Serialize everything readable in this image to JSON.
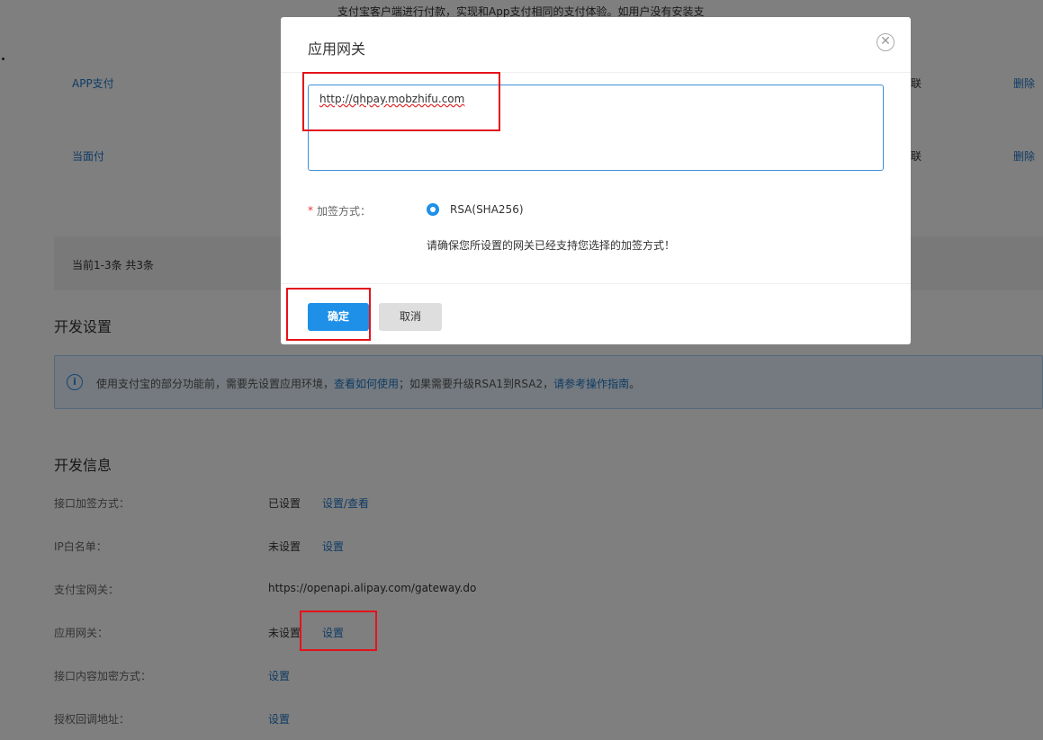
{
  "background": {
    "top_desc": "支付宝客户端进行付款，实现和App支付相同的支付体验。如用户没有安装支",
    "product_rows": [
      {
        "name": "APP支付",
        "tail": "联",
        "action": "删除"
      },
      {
        "name": "当面付",
        "tail": "联",
        "action": "删除"
      }
    ],
    "pager_text": "当前1-3条 共3条",
    "dev_settings_title": "开发设置",
    "notice": {
      "icon": "info-icon",
      "text_before": "使用支付宝的部分功能前，需要先设置应用环境，",
      "link1": "查看如何使用",
      "text_middle": "；如果需要升级RSA1到RSA2，",
      "link2": "请参考操作指南",
      "text_after": "。"
    },
    "dev_info_title": "开发信息",
    "dev_info": [
      {
        "label": "接口加签方式：",
        "status": "已设置",
        "action": "设置/查看"
      },
      {
        "label": "IP白名单：",
        "status": "未设置",
        "action": "设置"
      },
      {
        "label": "支付宝网关：",
        "value": "https://openapi.alipay.com/gateway.do"
      },
      {
        "label": "应用网关：",
        "status": "未设置",
        "action": "设置"
      },
      {
        "label": "接口内容加密方式：",
        "action": "设置"
      },
      {
        "label": "授权回调地址：",
        "action": "设置"
      }
    ]
  },
  "dialog": {
    "title": "应用网关",
    "close_icon": "close-circle-icon",
    "gateway_value": "http://qhpay.mobzhifu.com",
    "required_mark": "*",
    "sign_label": "加签方式：",
    "sign_option": "RSA(SHA256)",
    "sign_hint": "请确保您所设置的网关已经支持您选择的加签方式！",
    "confirm_label": "确定",
    "cancel_label": "取消"
  },
  "colors": {
    "primary": "#1e90e8",
    "link": "#1e76c8",
    "highlight": "#e3131b"
  }
}
